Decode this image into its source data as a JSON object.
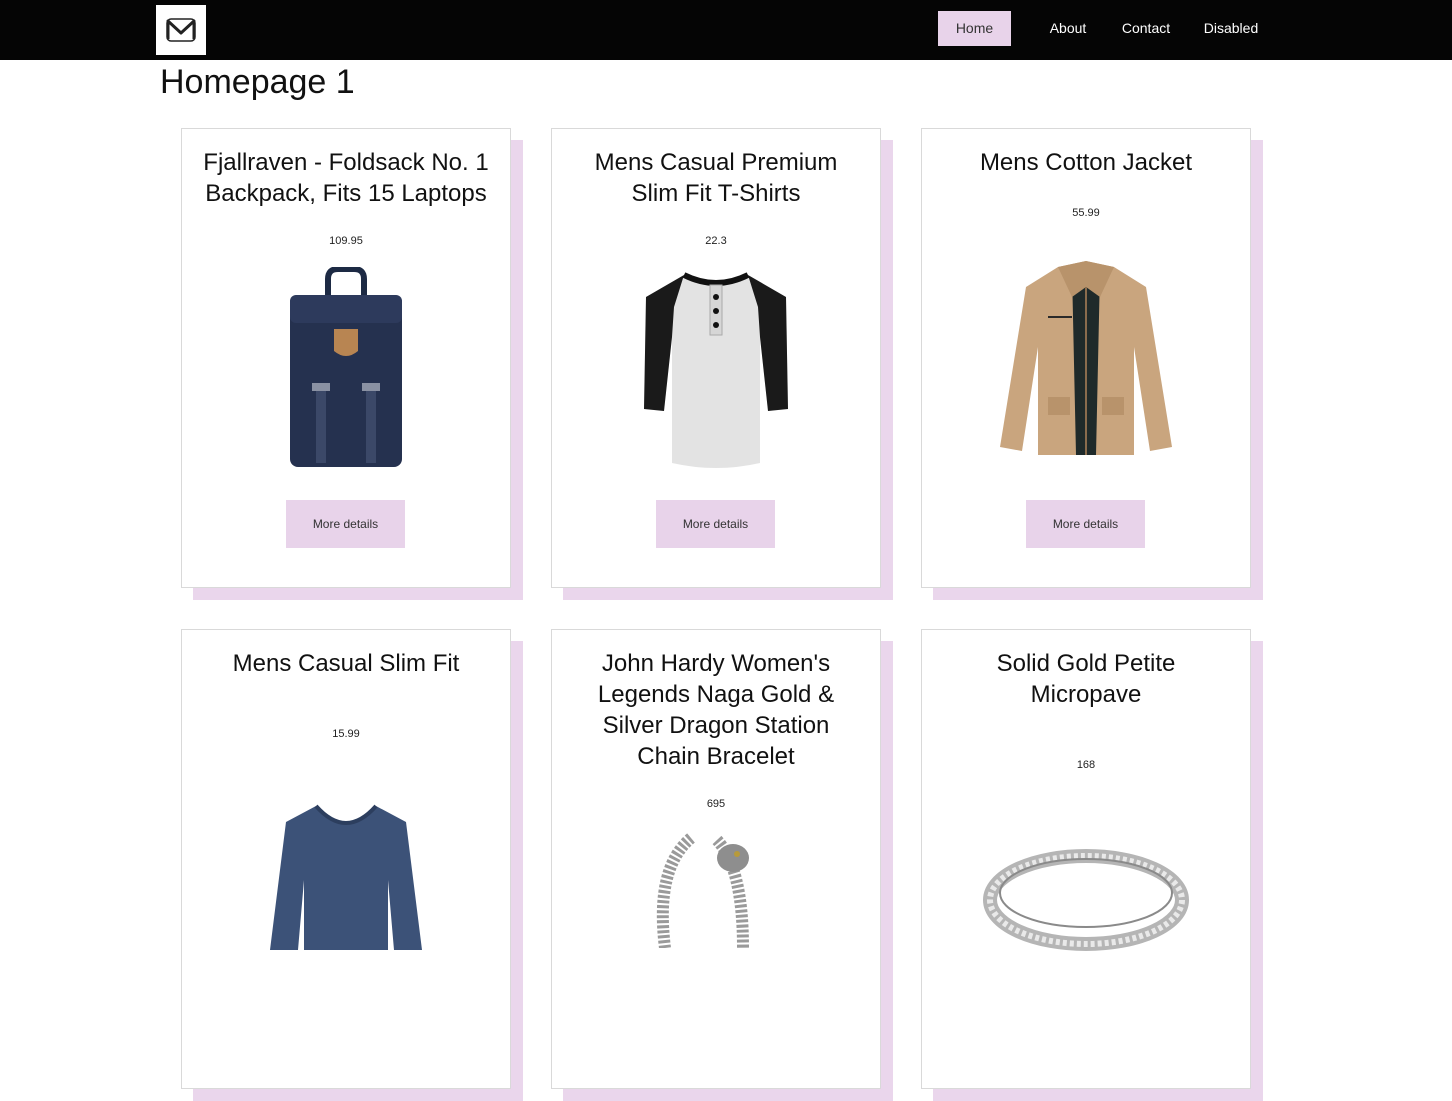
{
  "navbar": {
    "logo_letter": "M",
    "items": [
      {
        "label": "Home",
        "active": true
      },
      {
        "label": "About",
        "active": false
      },
      {
        "label": "Contact",
        "active": false
      },
      {
        "label": "Disabled",
        "active": false
      }
    ]
  },
  "page": {
    "title": "Homepage 1"
  },
  "products": [
    {
      "title": "Fjallraven - Foldsack No. 1 Backpack, Fits 15 Laptops",
      "price": "109.95",
      "image": "backpack",
      "button": "More details"
    },
    {
      "title": "Mens Casual Premium Slim Fit T-Shirts",
      "price": "22.3",
      "image": "raglan-tshirt",
      "button": "More details"
    },
    {
      "title": "Mens Cotton Jacket",
      "price": "55.99",
      "image": "jacket",
      "button": "More details"
    },
    {
      "title": "Mens Casual Slim Fit",
      "price": "15.99",
      "image": "long-sleeve-shirt",
      "button": "More details"
    },
    {
      "title": "John Hardy Women's Legends Naga Gold & Silver Dragon Station Chain Bracelet",
      "price": "695",
      "image": "dragon-bracelet",
      "button": "More details"
    },
    {
      "title": "Solid Gold Petite Micropave",
      "price": "168",
      "image": "ring",
      "button": "More details"
    }
  ],
  "colors": {
    "accent": "#e8d3ea",
    "navbar": "#050505"
  }
}
